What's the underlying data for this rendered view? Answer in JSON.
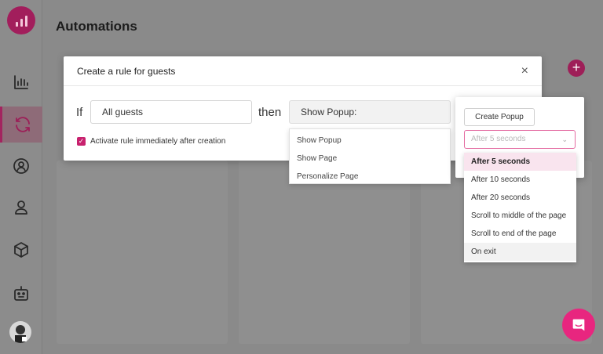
{
  "header": {
    "title": "Automations"
  },
  "modal": {
    "title": "Create a rule for guests",
    "close": "×",
    "if_label": "If",
    "guests_value": "All guests",
    "then_label": "then",
    "action_value": "Show Popup:",
    "checkbox_label": "Activate rule immediately after creation"
  },
  "action_menu": [
    "Show Popup",
    "Show Page",
    "Personalize Page"
  ],
  "popup_panel": {
    "create_button": "Create Popup",
    "timing_placeholder": "After 5 seconds"
  },
  "timing_menu": [
    "After 5 seconds",
    "After 10 seconds",
    "After 20 seconds",
    "Scroll to middle of the page",
    "Scroll to end of the page",
    "On exit"
  ],
  "colors": {
    "brand": "#e8267f",
    "accent_dark": "#a21e5c"
  }
}
